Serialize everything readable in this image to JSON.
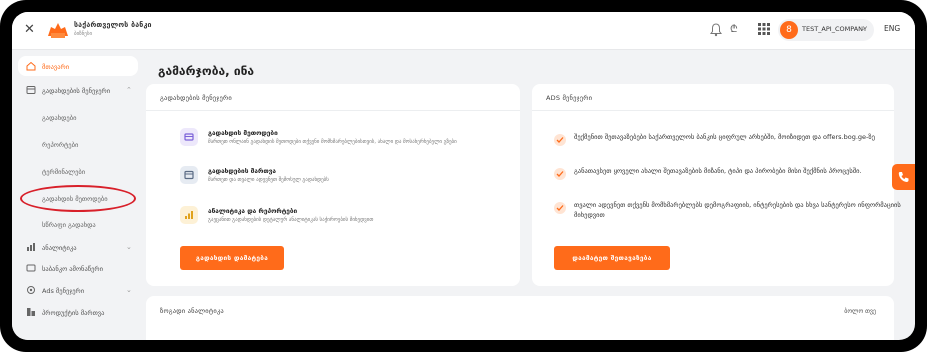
{
  "topbar": {
    "close_glyph": "✕",
    "brand_name": "საქართველოს ბანკი",
    "brand_sub": "ბიზნესი",
    "currency_glyph": "₾",
    "company": "TEST_API_COMPANY",
    "avatar_letter": "8",
    "language": "ENG",
    "icons": [
      "close-icon",
      "bank-logo",
      "bell-icon",
      "currency-icon",
      "apps-grid-icon",
      "chevron-down-icon"
    ]
  },
  "sidebar": {
    "home": "მთავარი",
    "payment_management": "გადახდების მენეჯერი",
    "sub_payments": "გადახდები",
    "sub_reports": "რეპორტები",
    "sub_terminals": "ტერმინალები",
    "sub_payment_methods": "გადახდის მეთოდები",
    "sub_quick_payment": "სწრაფი გადახდა",
    "analytics": "ანალიტიკა",
    "statements": "საბანკო ამონაწერი",
    "ads_manager": "Ads მენეჯერი",
    "products": "პროდუქტის მართვა",
    "accent_color": "#ff6b1a",
    "highlight_color": "#d8202a"
  },
  "main": {
    "greeting": "გამარჯობა, ინა",
    "payments_card": {
      "title": "გადახდების მენეჯერი",
      "features": [
        {
          "title": "გადახდის მეთოდები",
          "desc": "მართეთ ონლაინ გადახდის მეთოდები თქვენი მომხმარებლებისთვის, ახალი და მოსახერხებელი გზები"
        },
        {
          "title": "გადახდების მართვა",
          "desc": "მართეთ და თვალი ადევნეთ შემოსულ გადახდებს"
        },
        {
          "title": "ანალიტიკა და რეპორტები",
          "desc": "გაეცანით გადახდების დეტალურ ანალიტიკას საჭიროების მიხედვით"
        }
      ],
      "button": "გადახდის დამატება"
    },
    "ads_card": {
      "title": "ADS მენეჯერი",
      "rows": [
        "შექმენით შეთავაზებები საქართველოს ბანკის ციფრულ არხებში, მოიზიდეთ და offers.bog.ge-ზე",
        "განათავსეთ ყოველი ახალი შეთავაზების მიზანი, ტიპი და პირობები მისი შექმნის პროცესში.",
        "თვალი ადევნეთ თქვენს მომხმარებლებს დემოგრაფიის, ინტერესების და სხვა სანტერესო ინფორმაციის მიხედვით"
      ],
      "button": "დაამატეთ შეთავაზება"
    },
    "bottom_card": {
      "title": "ზოგადი ანალიტიკა",
      "right_label": "ბოლო თვე"
    }
  }
}
